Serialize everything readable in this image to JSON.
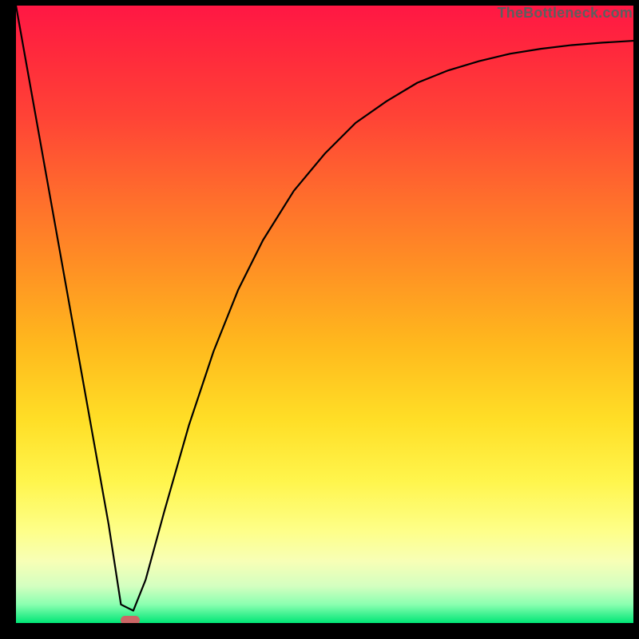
{
  "watermark": "TheBottleneck.com",
  "chart_data": {
    "type": "line",
    "title": "",
    "xlabel": "",
    "ylabel": "",
    "xlim": [
      0,
      100
    ],
    "ylim": [
      0,
      100
    ],
    "grid": false,
    "legend": false,
    "series": [
      {
        "name": "bottleneck-curve",
        "x": [
          0,
          5,
          10,
          15,
          17,
          19,
          21,
          24,
          28,
          32,
          36,
          40,
          45,
          50,
          55,
          60,
          65,
          70,
          75,
          80,
          85,
          90,
          95,
          100
        ],
        "y": [
          100,
          72,
          44,
          16,
          3,
          2,
          7,
          18,
          32,
          44,
          54,
          62,
          70,
          76,
          81,
          84.5,
          87.5,
          89.5,
          91,
          92.2,
          93,
          93.6,
          94,
          94.3
        ]
      }
    ],
    "marker": {
      "x": 18.5,
      "y": 0.5,
      "w": 3.2,
      "h": 1.4
    },
    "gradient_stops": [
      {
        "pos": 0,
        "color": "#ff1744"
      },
      {
        "pos": 8,
        "color": "#ff2a3c"
      },
      {
        "pos": 18,
        "color": "#ff4336"
      },
      {
        "pos": 30,
        "color": "#ff6a2d"
      },
      {
        "pos": 42,
        "color": "#ff8f24"
      },
      {
        "pos": 55,
        "color": "#ffb91d"
      },
      {
        "pos": 67,
        "color": "#ffde26"
      },
      {
        "pos": 77,
        "color": "#fff54c"
      },
      {
        "pos": 85,
        "color": "#feff88"
      },
      {
        "pos": 90,
        "color": "#f7ffb6"
      },
      {
        "pos": 94,
        "color": "#d4ffc0"
      },
      {
        "pos": 97,
        "color": "#8affb0"
      },
      {
        "pos": 100,
        "color": "#00e676"
      }
    ]
  }
}
